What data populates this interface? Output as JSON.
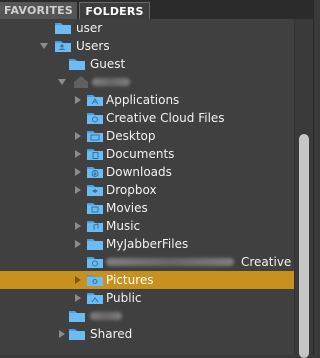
{
  "tabs": {
    "favorites": "FAVORITES",
    "folders": "FOLDERS"
  },
  "tree": [
    {
      "label": "user",
      "level": 1,
      "expanded": null,
      "icon": "folder-icon",
      "selected": false,
      "blurred": false
    },
    {
      "label": "Users",
      "level": 1,
      "expanded": true,
      "icon": "users-folder-icon",
      "selected": false,
      "blurred": false
    },
    {
      "label": "Guest",
      "level": 2,
      "expanded": null,
      "icon": "folder-icon",
      "selected": false,
      "blurred": false
    },
    {
      "label": "",
      "level": 2,
      "expanded": true,
      "icon": "home-icon",
      "selected": false,
      "blurred": true
    },
    {
      "label": "Applications",
      "level": 3,
      "expanded": false,
      "icon": "applications-folder-icon",
      "selected": false,
      "blurred": false
    },
    {
      "label": "Creative Cloud Files",
      "level": 3,
      "expanded": null,
      "icon": "creative-cloud-folder-icon",
      "selected": false,
      "blurred": false
    },
    {
      "label": "Desktop",
      "level": 3,
      "expanded": false,
      "icon": "desktop-folder-icon",
      "selected": false,
      "blurred": false
    },
    {
      "label": "Documents",
      "level": 3,
      "expanded": false,
      "icon": "documents-folder-icon",
      "selected": false,
      "blurred": false
    },
    {
      "label": "Downloads",
      "level": 3,
      "expanded": false,
      "icon": "downloads-folder-icon",
      "selected": false,
      "blurred": false
    },
    {
      "label": "Dropbox",
      "level": 3,
      "expanded": false,
      "icon": "dropbox-folder-icon",
      "selected": false,
      "blurred": false
    },
    {
      "label": "Movies",
      "level": 3,
      "expanded": null,
      "icon": "movies-folder-icon",
      "selected": false,
      "blurred": false
    },
    {
      "label": "Music",
      "level": 3,
      "expanded": false,
      "icon": "music-folder-icon",
      "selected": false,
      "blurred": false
    },
    {
      "label": "MyJabberFiles",
      "level": 3,
      "expanded": false,
      "icon": "folder-icon",
      "selected": false,
      "blurred": false
    },
    {
      "label": "Creative C",
      "level": 3,
      "expanded": null,
      "icon": "creative-cloud-folder-icon",
      "selected": false,
      "blurred": true
    },
    {
      "label": "Pictures",
      "level": 3,
      "expanded": false,
      "icon": "pictures-folder-icon",
      "selected": true,
      "blurred": false
    },
    {
      "label": "Public",
      "level": 3,
      "expanded": false,
      "icon": "public-folder-icon",
      "selected": false,
      "blurred": false
    },
    {
      "label": "",
      "level": 2,
      "expanded": null,
      "icon": "folder-icon",
      "selected": false,
      "blurred": true
    },
    {
      "label": "Shared",
      "level": 2,
      "expanded": false,
      "icon": "folder-icon",
      "selected": false,
      "blurred": false
    }
  ]
}
